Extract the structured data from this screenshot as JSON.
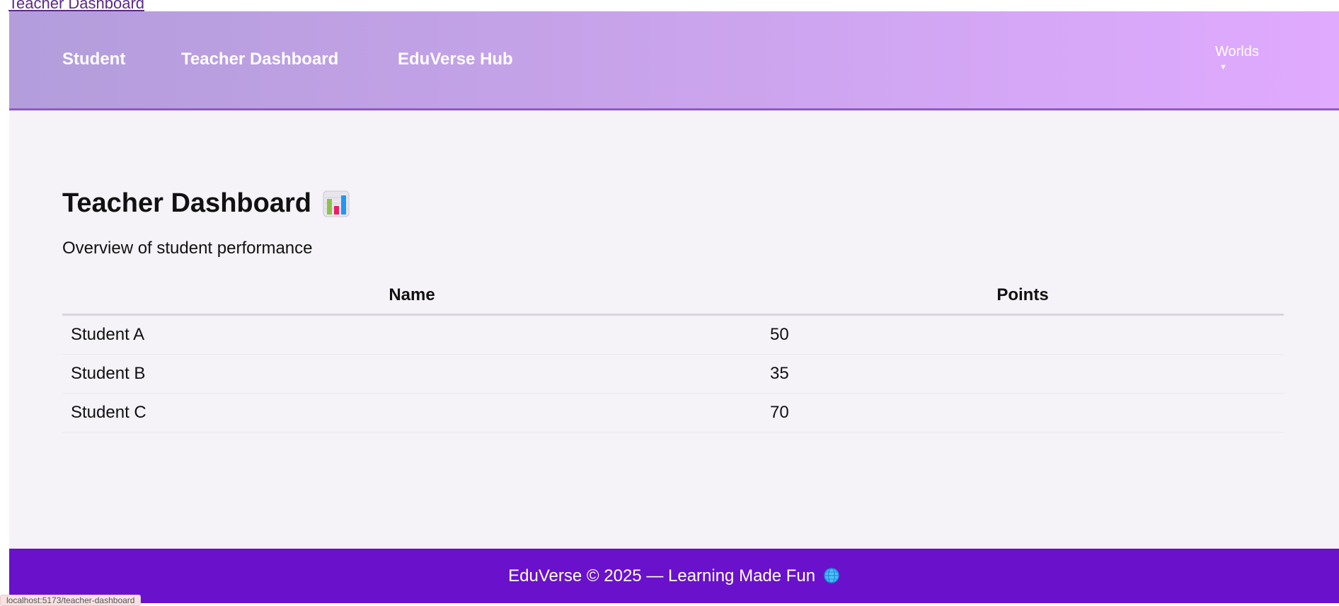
{
  "top_link": "Teacher Dashboard",
  "nav": {
    "student": "Student",
    "teacher_dashboard": "Teacher Dashboard",
    "eduverse_hub": "EduVerse Hub",
    "worlds": "Worlds",
    "worlds_arrow": "▼"
  },
  "main": {
    "title": "Teacher Dashboard",
    "title_icon": "bar-chart-icon",
    "subtitle": "Overview of student performance",
    "table": {
      "headers": [
        "Name",
        "Points"
      ],
      "rows": [
        {
          "name": "Student A",
          "points": "50"
        },
        {
          "name": "Student B",
          "points": "35"
        },
        {
          "name": "Student C",
          "points": "70"
        }
      ]
    }
  },
  "footer": {
    "text": "EduVerse © 2025 — Learning Made Fun",
    "icon": "globe-icon"
  },
  "status_url": "localhost:5173/teacher-dashboard",
  "colors": {
    "nav_gradient_start": "#b39ddb",
    "nav_gradient_end": "#e0aaff",
    "footer_bg": "#6a11cb",
    "page_bg": "#f5f2f8"
  }
}
